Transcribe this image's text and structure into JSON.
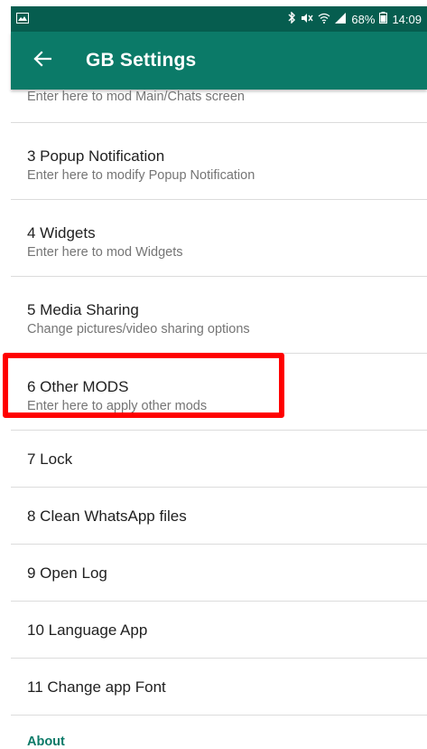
{
  "status_bar": {
    "battery": "68%",
    "time": "14:09",
    "icons": [
      "gallery-icon",
      "bluetooth-icon",
      "mute-icon",
      "wifi-icon",
      "signal-icon",
      "battery-icon"
    ]
  },
  "app_bar": {
    "title": "GB Settings",
    "back_icon": "arrow-back-icon",
    "background": "#0b7a68",
    "status_bar_background": "#065d4f"
  },
  "list": {
    "items": [
      {
        "title": "",
        "subtitle": "Enter here to mod Main/Chats screen"
      },
      {
        "title": "3 Popup Notification",
        "subtitle": "Enter here to modify Popup Notification"
      },
      {
        "title": "4 Widgets",
        "subtitle": "Enter here to mod Widgets"
      },
      {
        "title": "5 Media Sharing",
        "subtitle": "Change pictures/video sharing options"
      },
      {
        "title": "6 Other MODS",
        "subtitle": "Enter here to apply other mods"
      },
      {
        "title": "7 Lock"
      },
      {
        "title": "8 Clean WhatsApp files"
      },
      {
        "title": "9 Open Log"
      },
      {
        "title": "10 Language App"
      },
      {
        "title": "11 Change app Font"
      }
    ],
    "section_header": "About"
  },
  "highlight": {
    "color": "#ff0000",
    "target": "6 Other MODS"
  }
}
